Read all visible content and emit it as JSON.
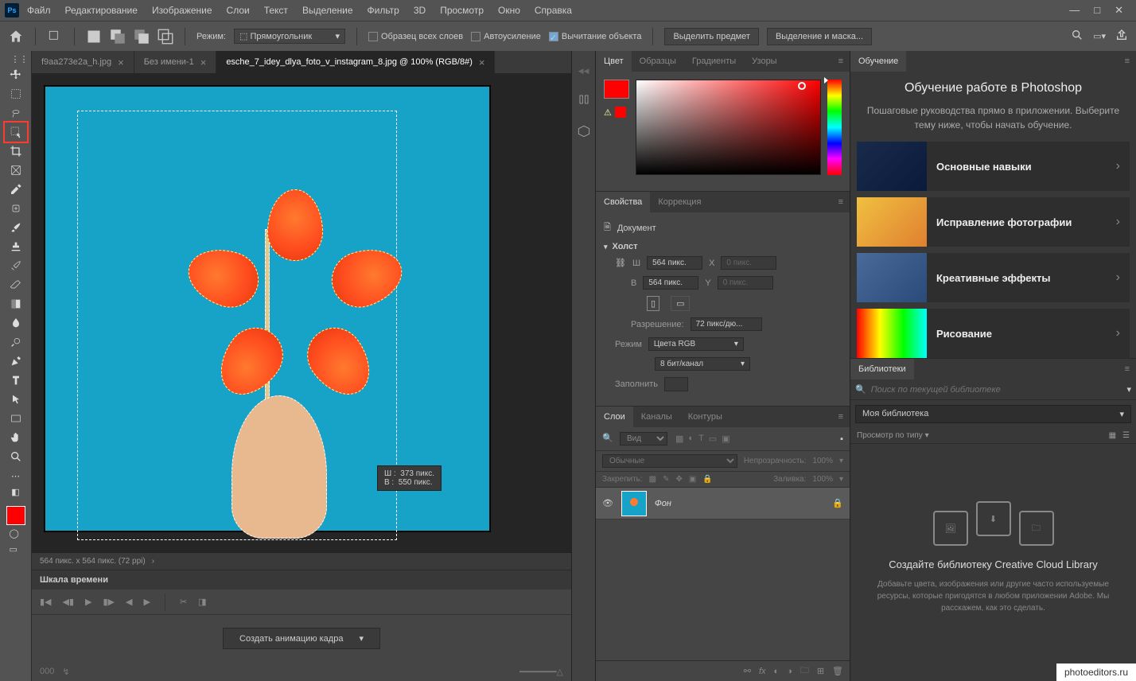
{
  "menubar": {
    "items": [
      "Файл",
      "Редактирование",
      "Изображение",
      "Слои",
      "Текст",
      "Выделение",
      "Фильтр",
      "3D",
      "Просмотр",
      "Окно",
      "Справка"
    ]
  },
  "optionsbar": {
    "mode_label": "Режим:",
    "mode_value": "Прямоугольник",
    "check_sample": "Образец всех слоев",
    "check_enhance": "Автоусиление",
    "check_subtract": "Вычитание объекта",
    "btn_select_subject": "Выделить предмет",
    "btn_select_mask": "Выделение и маска..."
  },
  "tabs": [
    {
      "label": "f9aa273e2a_h.jpg",
      "active": false
    },
    {
      "label": "Без имени-1",
      "active": false
    },
    {
      "label": "esche_7_idey_dlya_foto_v_instagram_8.jpg @ 100% (RGB/8#)",
      "active": true
    }
  ],
  "canvas": {
    "tooltip_w_label": "Ш :",
    "tooltip_w_value": "373 пикс.",
    "tooltip_h_label": "В :",
    "tooltip_h_value": "550 пикс."
  },
  "statusbar": {
    "text": "564 пикс. x 564 пикс. (72 ppi)"
  },
  "timeline": {
    "title": "Шкала времени",
    "create_btn": "Создать анимацию кадра",
    "footer": "000"
  },
  "color_panel": {
    "tabs": [
      "Цвет",
      "Образцы",
      "Градиенты",
      "Узоры"
    ]
  },
  "properties": {
    "tabs": [
      "Свойства",
      "Коррекция"
    ],
    "doc_label": "Документ",
    "canvas_section": "Холст",
    "w_label": "Ш",
    "w_value": "564 пикс.",
    "x_label": "X",
    "x_value": "0 пикс.",
    "h_label": "В",
    "h_value": "564 пикс.",
    "y_label": "Y",
    "y_value": "0 пикс.",
    "resolution_label": "Разрешение:",
    "resolution_value": "72 пикс/дю...",
    "mode_label": "Режим",
    "mode_value": "Цвета RGB",
    "depth_value": "8 бит/канал",
    "fill_label": "Заполнить"
  },
  "layers": {
    "tabs": [
      "Слои",
      "Каналы",
      "Контуры"
    ],
    "filter_label": "Вид",
    "blend_label": "Обычные",
    "opacity_label": "Непрозрачность:",
    "opacity_value": "100%",
    "lock_label": "Закрепить:",
    "fill_label": "Заливка:",
    "fill_value": "100%",
    "layer_name": "Фон"
  },
  "learn": {
    "tab": "Обучение",
    "title": "Обучение работе в Photoshop",
    "subtitle": "Пошаговые руководства прямо в приложении. Выберите тему ниже, чтобы начать обучение.",
    "items": [
      "Основные навыки",
      "Исправление фотографии",
      "Креативные эффекты",
      "Рисование"
    ]
  },
  "libraries": {
    "tab": "Библиотеки",
    "search_placeholder": "Поиск по текущей библиотеке",
    "lib_select": "Моя библиотека",
    "view_label": "Просмотр по типу",
    "empty_title": "Создайте библиотеку Creative Cloud Library",
    "empty_desc": "Добавьте цвета, изображения или другие часто используемые ресурсы, которые пригодятся в любом приложении Adobe. Мы расскажем, как это сделать."
  },
  "watermark": "photoeditors.ru"
}
